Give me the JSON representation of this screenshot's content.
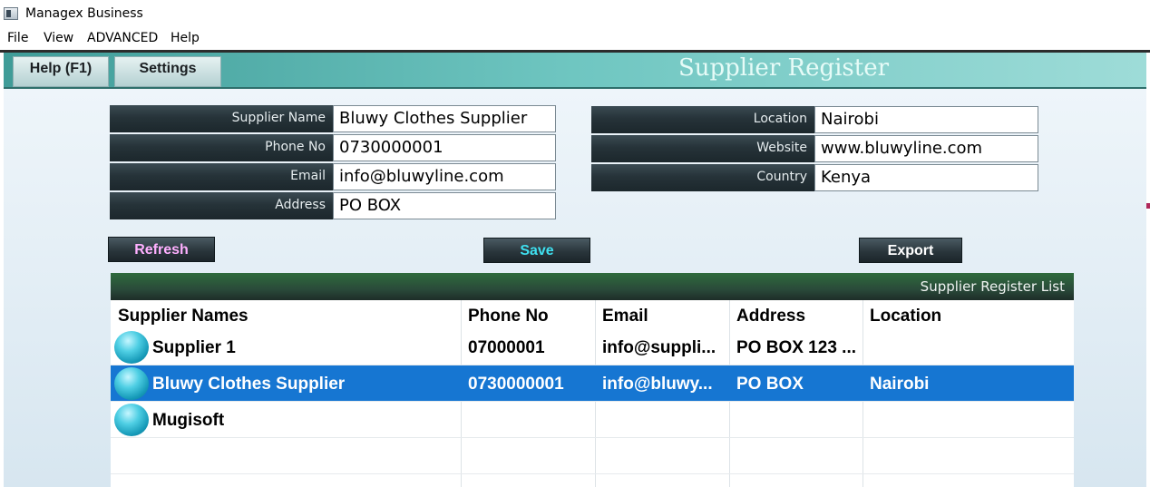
{
  "window": {
    "title": "Managex Business"
  },
  "menu": {
    "items": [
      "File",
      "View",
      "ADVANCED",
      "Help"
    ]
  },
  "header": {
    "help_button": "Help (F1)",
    "settings_button": "Settings",
    "page_title": "Supplier Register"
  },
  "form": {
    "left": [
      {
        "label": "Supplier Name",
        "value": "Bluwy Clothes Supplier"
      },
      {
        "label": "Phone No",
        "value": "0730000001"
      },
      {
        "label": "Email",
        "value": "info@bluwyline.com"
      },
      {
        "label": "Address",
        "value": "PO BOX"
      }
    ],
    "right": [
      {
        "label": "Location",
        "value": "Nairobi"
      },
      {
        "label": "Website",
        "value": "www.bluwyline.com"
      },
      {
        "label": "Country",
        "value": "Kenya"
      }
    ]
  },
  "actions": {
    "refresh": "Refresh",
    "save": "Save",
    "export": "Export",
    "colors": {
      "refresh": "#ffb0ff",
      "save": "#3fe0f0",
      "export": "#ffffff"
    }
  },
  "list": {
    "title": "Supplier Register List",
    "columns": [
      "Supplier Names",
      "Phone No",
      "Email",
      "Address",
      "Location"
    ],
    "rows": [
      {
        "name": "Supplier 1",
        "phone": "07000001",
        "email": "info@suppli...",
        "address": "PO BOX 123 ...",
        "location": "",
        "selected": false
      },
      {
        "name": "Bluwy Clothes Supplier",
        "phone": "0730000001",
        "email": "info@bluwy...",
        "address": "PO BOX",
        "location": "Nairobi",
        "selected": true
      },
      {
        "name": "Mugisoft",
        "phone": "",
        "email": "",
        "address": "",
        "location": "",
        "selected": false
      }
    ]
  },
  "colors": {
    "selection": "#1676d2",
    "header_teal": "#6fc6c1",
    "list_header_green": "#2e6b3c"
  }
}
